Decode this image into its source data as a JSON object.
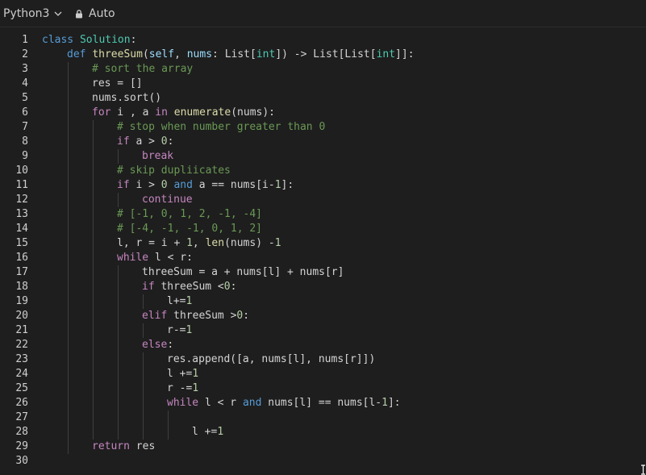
{
  "toolbar": {
    "language": "Python3",
    "mode": "Auto"
  },
  "editor": {
    "lines": [
      {
        "n": "1",
        "indent": 0,
        "tokens": [
          [
            "kw",
            "class"
          ],
          [
            "p",
            " "
          ],
          [
            "cls",
            "Solution"
          ],
          [
            "p",
            ":"
          ]
        ]
      },
      {
        "n": "2",
        "indent": 1,
        "tokens": [
          [
            "kw",
            "def"
          ],
          [
            "p",
            " "
          ],
          [
            "fn",
            "threeSum"
          ],
          [
            "p",
            "("
          ],
          [
            "var",
            "self"
          ],
          [
            "p",
            ", "
          ],
          [
            "var",
            "nums"
          ],
          [
            "p",
            ": List["
          ],
          [
            "cls",
            "int"
          ],
          [
            "p",
            "]) -> List[List["
          ],
          [
            "cls",
            "int"
          ],
          [
            "p",
            "]]:"
          ]
        ]
      },
      {
        "n": "3",
        "indent": 2,
        "tokens": [
          [
            "cm",
            "# sort the array"
          ]
        ]
      },
      {
        "n": "4",
        "indent": 2,
        "tokens": [
          [
            "p",
            "res = []"
          ]
        ]
      },
      {
        "n": "5",
        "indent": 2,
        "tokens": [
          [
            "p",
            "nums.sort()"
          ]
        ]
      },
      {
        "n": "6",
        "indent": 2,
        "tokens": [
          [
            "ctl",
            "for"
          ],
          [
            "p",
            " i , a "
          ],
          [
            "ctl",
            "in"
          ],
          [
            "p",
            " "
          ],
          [
            "fn",
            "enumerate"
          ],
          [
            "p",
            "(nums):"
          ]
        ]
      },
      {
        "n": "7",
        "indent": 3,
        "tokens": [
          [
            "cm",
            "# stop when number greater than 0"
          ]
        ]
      },
      {
        "n": "8",
        "indent": 3,
        "tokens": [
          [
            "ctl",
            "if"
          ],
          [
            "p",
            " a > "
          ],
          [
            "num",
            "0"
          ],
          [
            "p",
            ":"
          ]
        ]
      },
      {
        "n": "9",
        "indent": 4,
        "tokens": [
          [
            "ctl",
            "break"
          ]
        ]
      },
      {
        "n": "10",
        "indent": 3,
        "tokens": [
          [
            "cm",
            "# skip dupliicates"
          ]
        ]
      },
      {
        "n": "11",
        "indent": 3,
        "tokens": [
          [
            "ctl",
            "if"
          ],
          [
            "p",
            " i > "
          ],
          [
            "num",
            "0"
          ],
          [
            "p",
            " "
          ],
          [
            "kw",
            "and"
          ],
          [
            "p",
            " a == nums[i-"
          ],
          [
            "num",
            "1"
          ],
          [
            "p",
            "]:"
          ]
        ]
      },
      {
        "n": "12",
        "indent": 4,
        "tokens": [
          [
            "ctl",
            "continue"
          ]
        ]
      },
      {
        "n": "13",
        "indent": 3,
        "tokens": [
          [
            "cm",
            "# [-1, 0, 1, 2, -1, -4]"
          ]
        ]
      },
      {
        "n": "14",
        "indent": 3,
        "tokens": [
          [
            "cm",
            "# [-4, -1, -1, 0, 1, 2]"
          ]
        ]
      },
      {
        "n": "15",
        "indent": 3,
        "tokens": [
          [
            "p",
            "l, r = i + "
          ],
          [
            "num",
            "1"
          ],
          [
            "p",
            ", "
          ],
          [
            "fn",
            "len"
          ],
          [
            "p",
            "(nums) -"
          ],
          [
            "num",
            "1"
          ]
        ]
      },
      {
        "n": "16",
        "indent": 3,
        "tokens": [
          [
            "ctl",
            "while"
          ],
          [
            "p",
            " l < r:"
          ]
        ]
      },
      {
        "n": "17",
        "indent": 4,
        "tokens": [
          [
            "p",
            "threeSum = a + nums[l] + nums[r]"
          ]
        ]
      },
      {
        "n": "18",
        "indent": 4,
        "tokens": [
          [
            "ctl",
            "if"
          ],
          [
            "p",
            " threeSum <"
          ],
          [
            "num",
            "0"
          ],
          [
            "p",
            ":"
          ]
        ]
      },
      {
        "n": "19",
        "indent": 5,
        "tokens": [
          [
            "p",
            "l+="
          ],
          [
            "num",
            "1"
          ]
        ]
      },
      {
        "n": "20",
        "indent": 4,
        "tokens": [
          [
            "ctl",
            "elif"
          ],
          [
            "p",
            " threeSum >"
          ],
          [
            "num",
            "0"
          ],
          [
            "p",
            ":"
          ]
        ]
      },
      {
        "n": "21",
        "indent": 5,
        "tokens": [
          [
            "p",
            "r-="
          ],
          [
            "num",
            "1"
          ]
        ]
      },
      {
        "n": "22",
        "indent": 4,
        "tokens": [
          [
            "ctl",
            "else"
          ],
          [
            "p",
            ":"
          ]
        ]
      },
      {
        "n": "23",
        "indent": 5,
        "tokens": [
          [
            "p",
            "res.append([a, nums[l], nums[r]])"
          ]
        ]
      },
      {
        "n": "24",
        "indent": 5,
        "tokens": [
          [
            "p",
            "l +="
          ],
          [
            "num",
            "1"
          ]
        ]
      },
      {
        "n": "25",
        "indent": 5,
        "tokens": [
          [
            "p",
            "r -="
          ],
          [
            "num",
            "1"
          ]
        ]
      },
      {
        "n": "26",
        "indent": 5,
        "tokens": [
          [
            "ctl",
            "while"
          ],
          [
            "p",
            " l < r "
          ],
          [
            "kw",
            "and"
          ],
          [
            "p",
            " nums[l] == nums[l-"
          ],
          [
            "num",
            "1"
          ],
          [
            "p",
            "]:"
          ]
        ]
      },
      {
        "n": "27",
        "indent": 6,
        "tokens": []
      },
      {
        "n": "28",
        "indent": 6,
        "tokens": [
          [
            "p",
            "l +="
          ],
          [
            "num",
            "1"
          ]
        ]
      },
      {
        "n": "29",
        "indent": 2,
        "tokens": [
          [
            "ctl",
            "return"
          ],
          [
            "p",
            " res"
          ]
        ]
      },
      {
        "n": "30",
        "indent": 0,
        "tokens": []
      }
    ]
  },
  "icons": {
    "language_dropdown": "chevron-down-icon",
    "mode": "lock-icon"
  }
}
